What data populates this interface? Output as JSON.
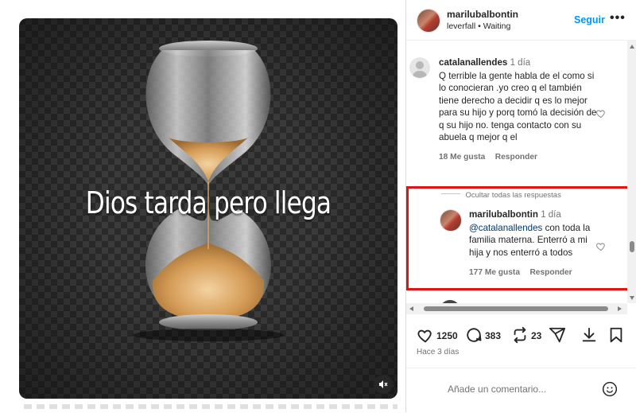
{
  "media": {
    "overlay_text": "Dios tarda pero llega"
  },
  "header": {
    "username": "marilubalbontin",
    "subtitle": "leverfall • Waiting",
    "follow_label": "Seguir",
    "more_label": "•••"
  },
  "comments": [
    {
      "username": "catalanallendes",
      "time": "1 día",
      "text": "Q terrible la gente habla de el como si lo conocieran .yo creo q el también tiene derecho a decidir q es lo mejor para su hijo y porq tomó la decisión de q su hijo no. tenga contacto con su abuela q mejor q el",
      "likes": "18 Me gusta",
      "reply_label": "Responder"
    }
  ],
  "hide_replies_label": "Ocultar todas las respuestas",
  "reply": {
    "username": "marilubalbontin",
    "time": "1 día",
    "mention": "@catalanallendes",
    "text": " con toda la familia materna. Enterró a mi hija y nos enterró a todos",
    "likes": "177 Me gusta",
    "reply_label": "Responder"
  },
  "actions": {
    "likes": "1250",
    "comments": "383",
    "reposts": "23"
  },
  "date": "Hace 3 días",
  "add_comment_placeholder": "Añade un comentario...",
  "colors": {
    "accent": "#0095f6",
    "highlight": "#e01414",
    "muted": "#737373"
  }
}
